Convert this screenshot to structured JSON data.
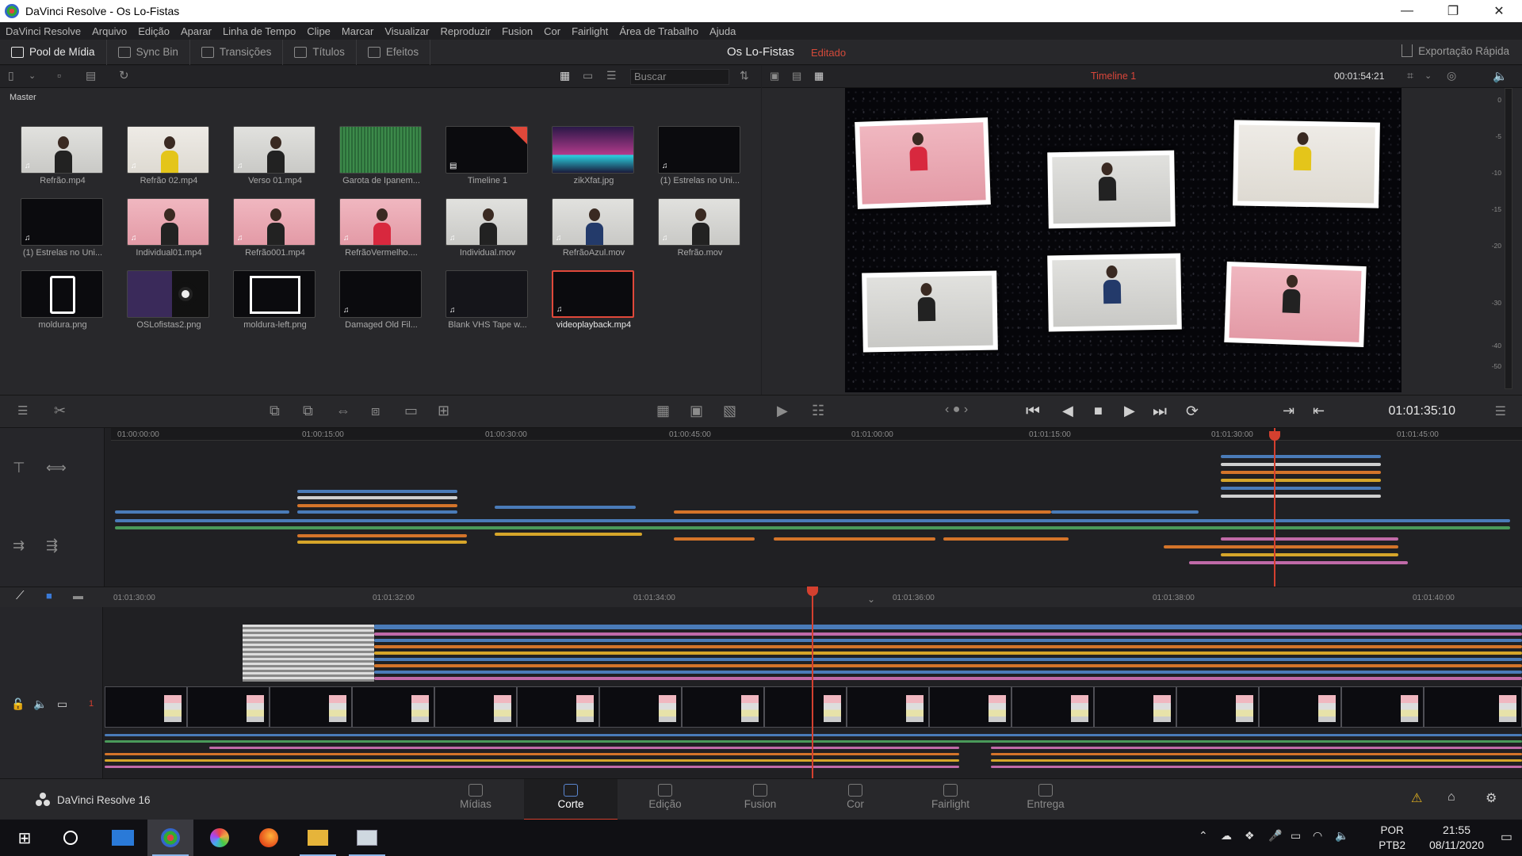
{
  "window": {
    "title": "DaVinci Resolve - Os Lo-Fistas",
    "minimize": "—",
    "maximize": "❐",
    "close": "✕"
  },
  "menu": [
    "DaVinci Resolve",
    "Arquivo",
    "Edição",
    "Aparar",
    "Linha de Tempo",
    "Clipe",
    "Marcar",
    "Visualizar",
    "Reproduzir",
    "Fusion",
    "Cor",
    "Fairlight",
    "Área de Trabalho",
    "Ajuda"
  ],
  "toolbar": {
    "media_pool": "Pool de Mídia",
    "sync_bin": "Sync Bin",
    "transitions": "Transições",
    "titles": "Títulos",
    "effects": "Efeitos",
    "project_name": "Os Lo-Fistas",
    "project_status": "Editado",
    "quick_export": "Exportação Rápida"
  },
  "media_pool": {
    "search_placeholder": "Buscar",
    "bin": "Master",
    "clips": [
      "Refrão.mp4",
      "Refrão 02.mp4",
      "Verso 01.mp4",
      "Garota de Ipanem...",
      "Timeline 1",
      "zikXfat.jpg",
      "(1) Estrelas no Uni...",
      "(1) Estrelas no Uni...",
      "Individual01.mp4",
      "Refrão001.mp4",
      "RefrãoVermelho....",
      "Individual.mov",
      "RefrãoAzul.mov",
      "Refrão.mov",
      "moldura.png",
      "OSLofistas2.png",
      "moldura-left.png",
      "Damaged Old Fil...",
      "Blank VHS Tape w...",
      "videoplayback.mp4"
    ]
  },
  "viewer": {
    "timeline_name": "Timeline 1",
    "duration_tc": "00:01:54:21",
    "current_tc": "01:01:35:10",
    "meter_ticks": [
      "0",
      "-5",
      "-10",
      "-15",
      "-20",
      "-30",
      "-40",
      "-50"
    ]
  },
  "upper_ruler": [
    "01:00:00:00",
    "01:00:15:00",
    "01:00:30:00",
    "01:00:45:00",
    "01:01:00:00",
    "01:01:15:00",
    "01:01:30:00",
    "01:01:45:00"
  ],
  "lower_ruler": [
    "01:01:30:00",
    "01:01:32:00",
    "01:01:34:00",
    "01:01:36:00",
    "01:01:38:00",
    "01:01:40:00"
  ],
  "lower_track_number": "1",
  "pagenav": {
    "brand": "DaVinci Resolve 16",
    "pages": [
      "Mídias",
      "Corte",
      "Edição",
      "Fusion",
      "Cor",
      "Fairlight",
      "Entrega"
    ],
    "active": "Corte"
  },
  "taskbar": {
    "lang1": "POR",
    "lang2": "PTB2",
    "time": "21:55",
    "date": "08/11/2020"
  },
  "colors": {
    "accent_red": "#d4402f",
    "track_blue": "#4a7bb8",
    "track_orange": "#d4742a",
    "track_yellow": "#d6a52a",
    "track_green": "#4a9a5a",
    "track_pink": "#c06aa8"
  }
}
